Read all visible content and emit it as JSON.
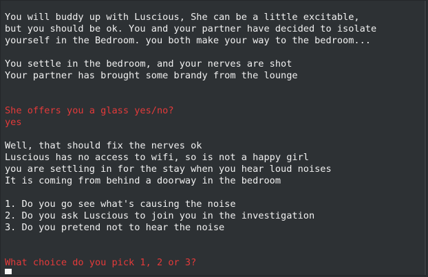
{
  "terminal": {
    "lines": {
      "l1": "You will buddy up with Luscious, She can be a little excitable,",
      "l2": "but you should be ok. You and your partner have decided to isolate",
      "l3": "yourself in the Bedroom. you both make your way to the bedroom...",
      "l4": "You settle in the bedroom, and your nerves are shot",
      "l5": "Your partner has brought some brandy from the lounge",
      "l6": "She offers you a glass yes/no?",
      "l7": "yes",
      "l8": "Well, that should fix the nerves ok",
      "l9": "Luscious has no access to wifi, so is not a happy girl",
      "l10": "you are settling in for the stay when you hear loud noises",
      "l11": "It is coming from behind a doorway in the bedroom",
      "l12": "1. Do you go see what's causing the noise",
      "l13": "2. Do you ask Luscious to join you in the investigation",
      "l14": "3. Do you pretend not to hear the noise",
      "l15": "What choice do you pick 1, 2 or 3?"
    },
    "colors": {
      "background": "#2d3134",
      "text": "#f1f1f1",
      "prompt": "#e53a3a"
    }
  }
}
